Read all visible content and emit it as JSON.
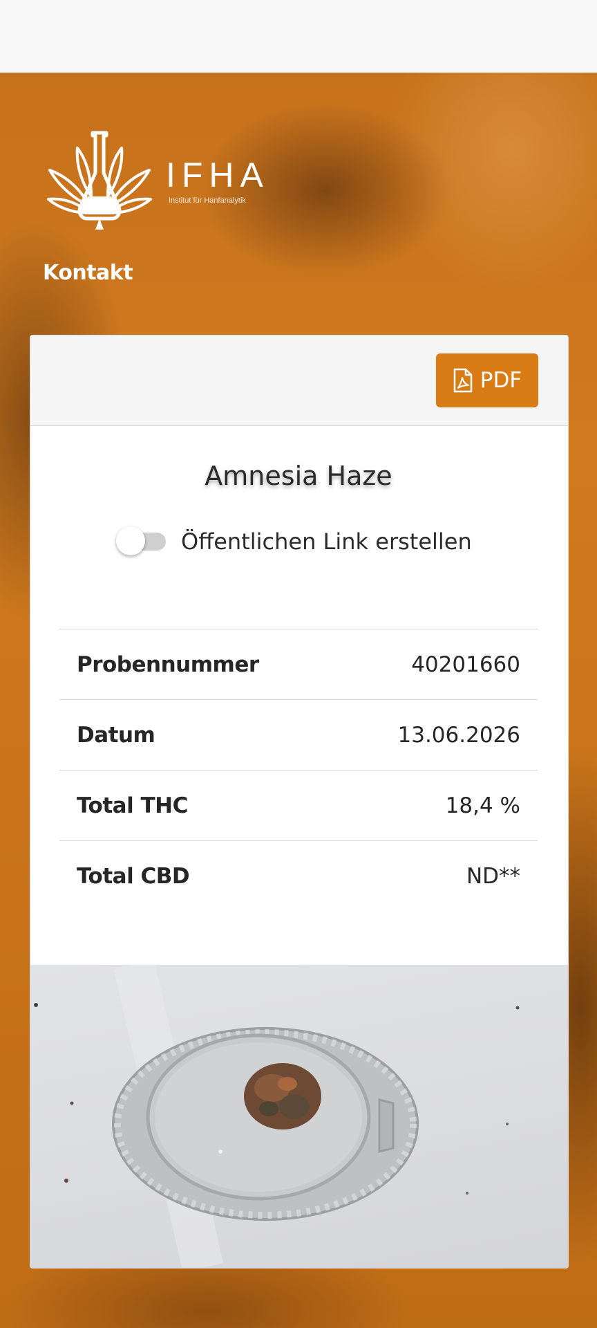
{
  "logo": {
    "name": "IFHA",
    "subtitle": "Institut für Hanfanalytik"
  },
  "nav": {
    "contact_label": "Kontakt"
  },
  "card": {
    "pdf_label": "PDF",
    "sample_name": "Amnesia Haze",
    "public_link_label": "Öffentlichen Link erstellen",
    "public_link_enabled": false,
    "rows": [
      {
        "label": "Probennummer",
        "value": "40201660"
      },
      {
        "label": "Datum",
        "value": "13.06.2026"
      },
      {
        "label": "Total THC",
        "value": "18,4 %"
      },
      {
        "label": "Total CBD",
        "value": "ND**"
      }
    ]
  },
  "colors": {
    "accent": "#d97c16",
    "hero_orange": "#cf7a1f"
  },
  "icons": {
    "pdf": "file-pdf-icon",
    "logo": "hemp-leaf-flask-logo"
  }
}
